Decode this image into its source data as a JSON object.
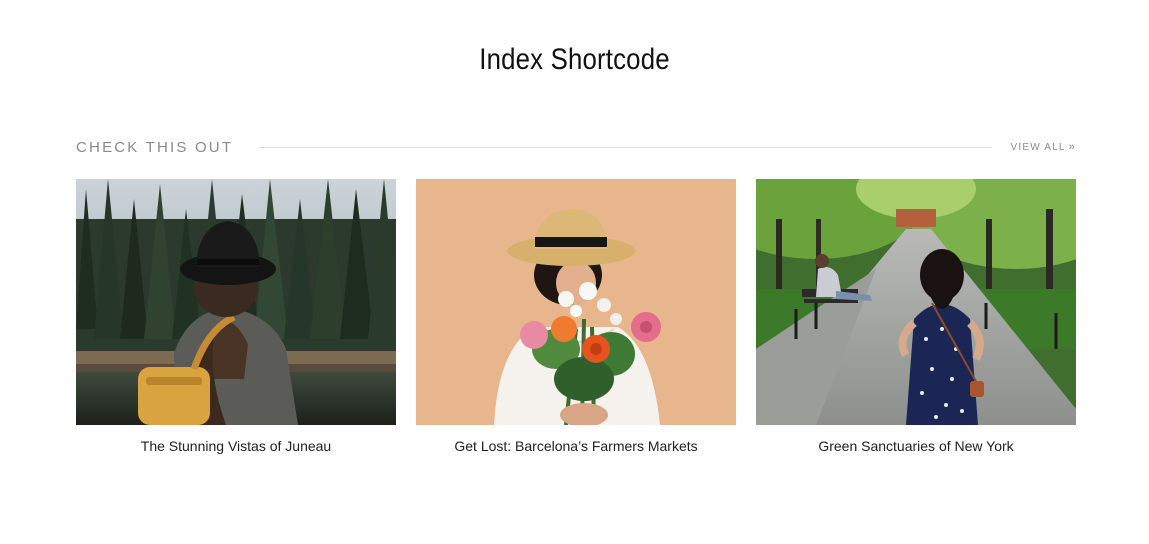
{
  "page": {
    "title": "Index Shortcode"
  },
  "section": {
    "heading": "CHECK THIS OUT",
    "view_all": "VIEW ALL",
    "view_all_icon": "double-chevron-right-icon"
  },
  "posts": [
    {
      "title": "The Stunning Vistas of Juneau",
      "image": "woman-in-black-hat-with-yellow-backpack-by-forest-lake"
    },
    {
      "title": "Get Lost: Barcelona’s Farmers Markets",
      "image": "woman-in-straw-hat-holding-flower-bouquet-on-peach-background"
    },
    {
      "title": "Green Sanctuaries of New York",
      "image": "woman-in-polka-dot-dress-walking-down-park-path"
    }
  ],
  "colors": {
    "heading_gray": "#8a8a8a",
    "divider": "#dddddd",
    "title_text": "#111111",
    "peach_background": "#e8b68c"
  }
}
